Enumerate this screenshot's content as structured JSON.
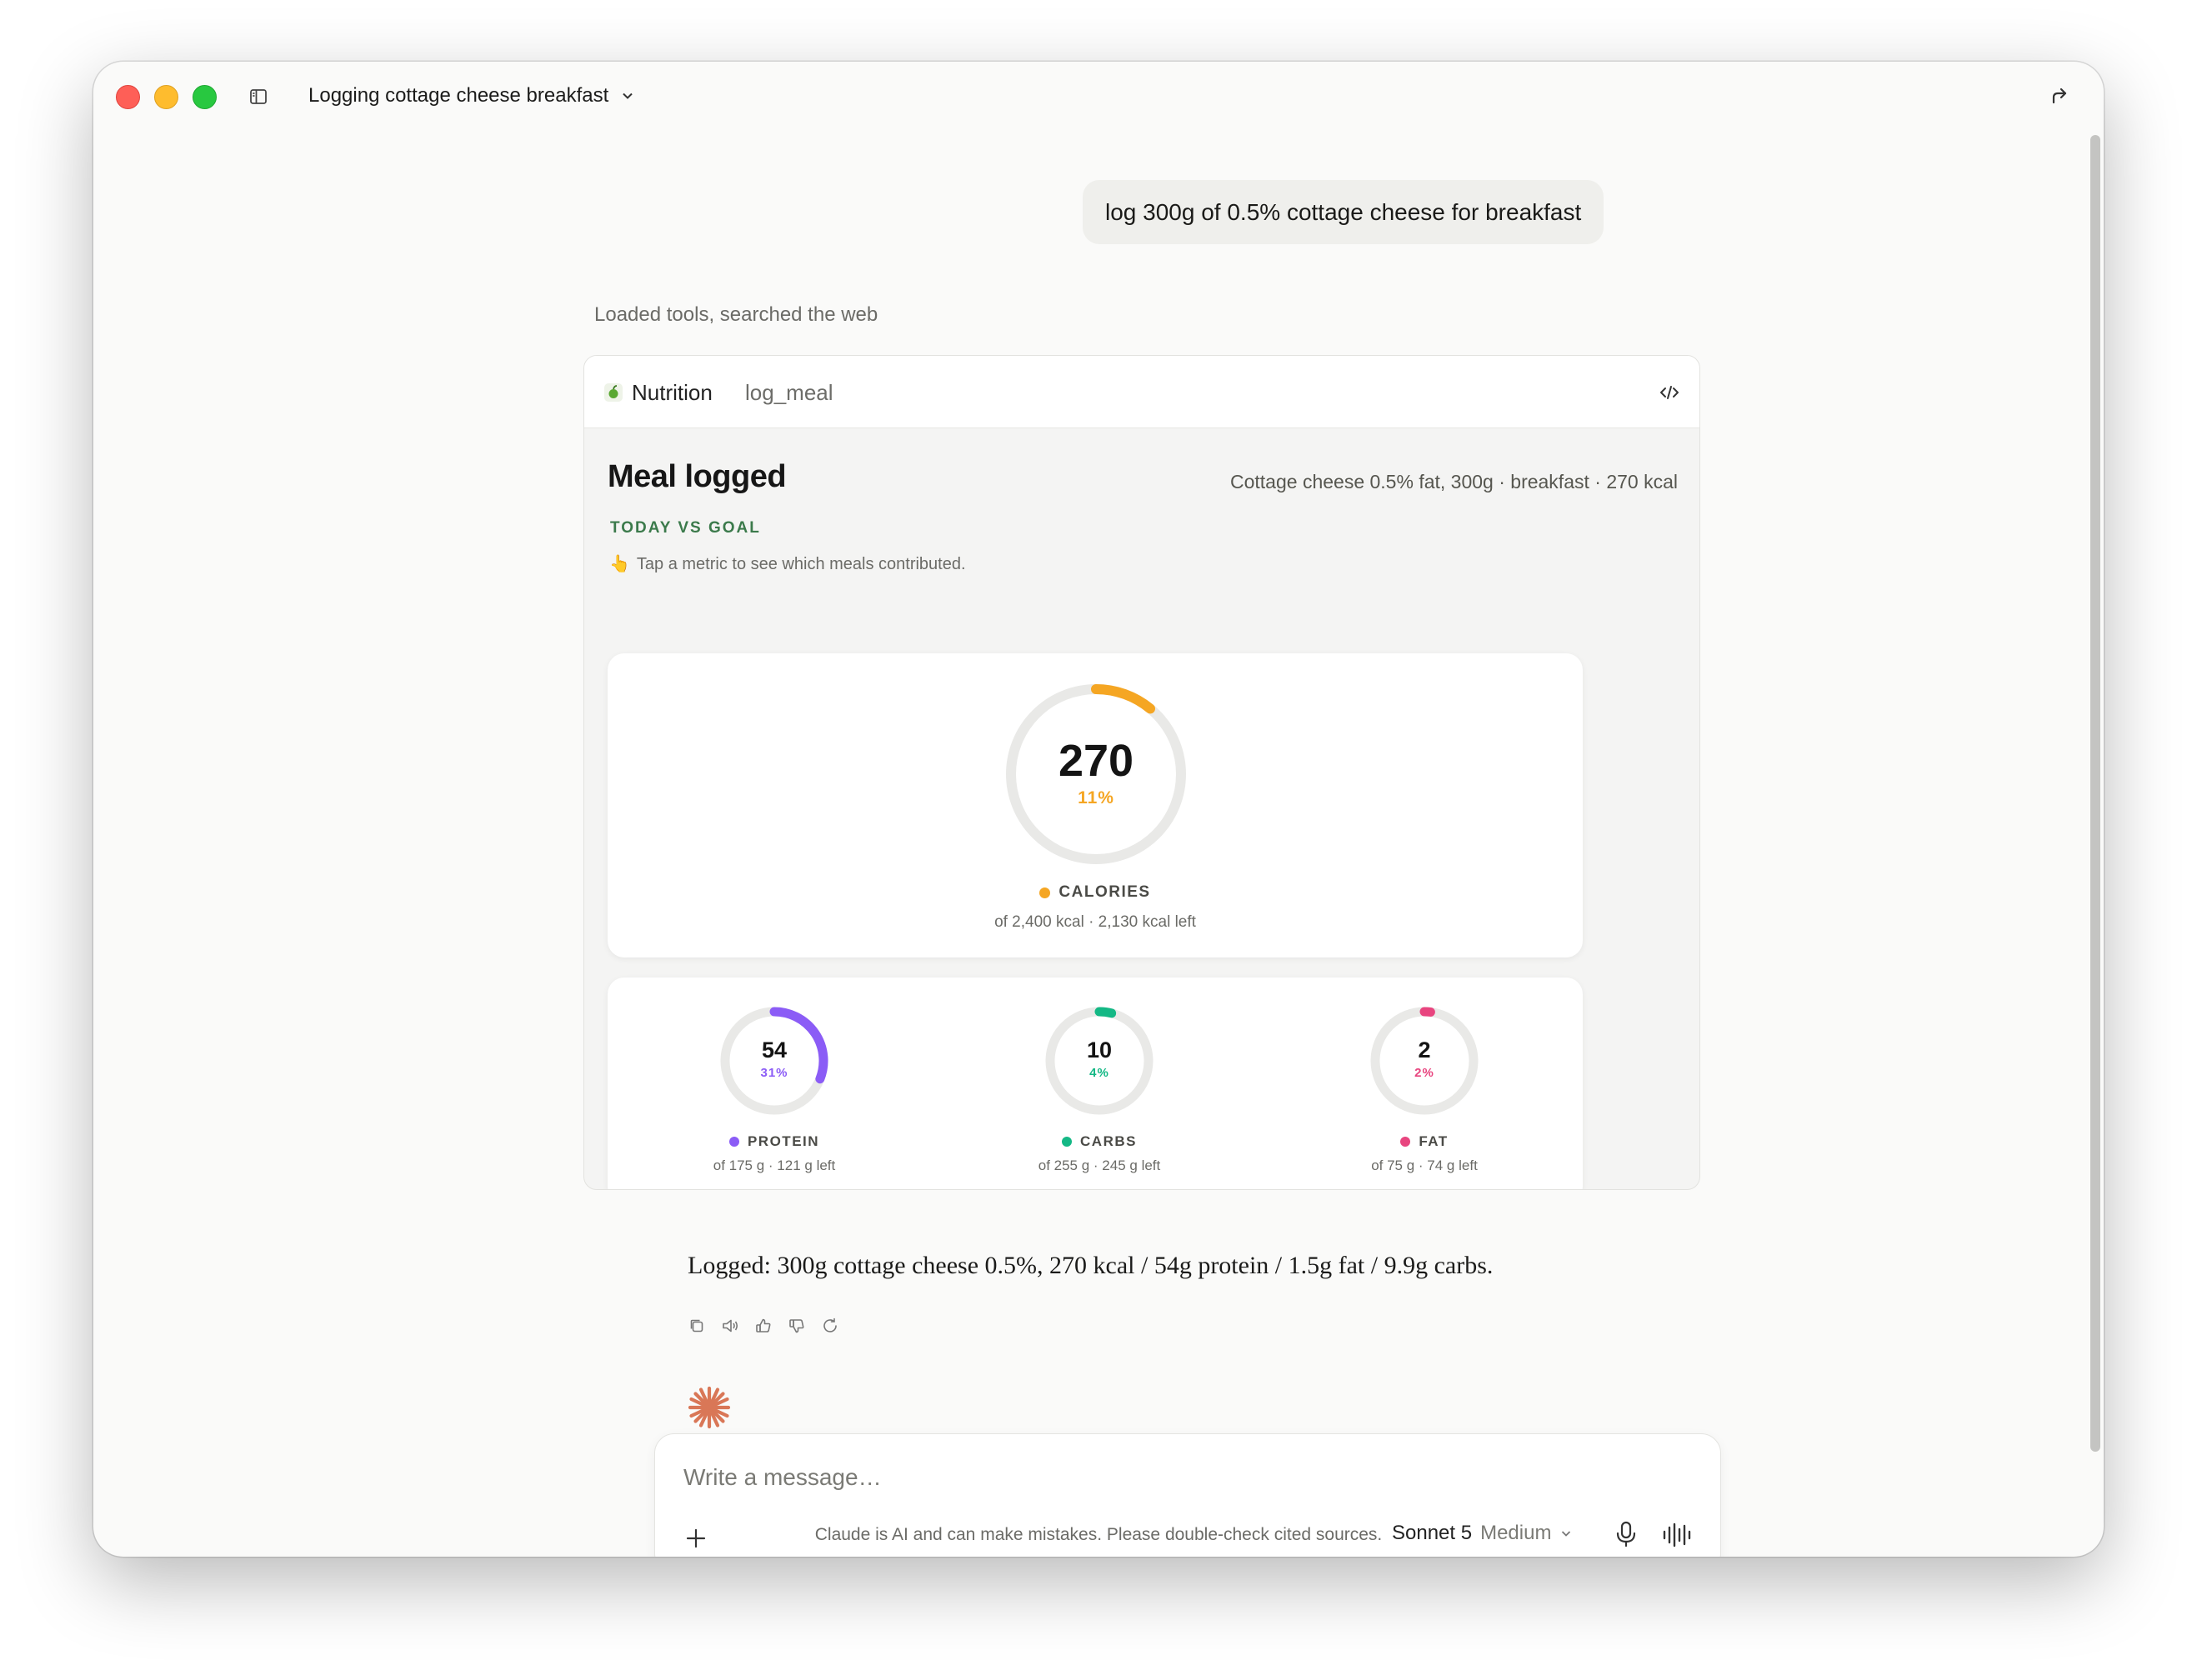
{
  "window": {
    "title": "Logging cottage cheese breakfast"
  },
  "conversation": {
    "user_message": "log 300g of 0.5% cottage cheese for breakfast",
    "tools_status": "Loaded tools, searched the web",
    "response_text": "Logged: 300g cottage cheese 0.5%, 270 kcal / 54g protein / 1.5g fat / 9.9g carbs."
  },
  "tool_card": {
    "app_name": "Nutrition",
    "tool_name": "log_meal",
    "heading": "Meal logged",
    "summary": "Cottage cheese 0.5% fat, 300g · breakfast · 270 kcal",
    "section_label": "TODAY VS GOAL",
    "hint_icon": "👆",
    "hint": "Tap a metric to see which meals contributed.",
    "calories": {
      "value": "270",
      "percent_label": "11%",
      "fraction": 0.11,
      "label": "CALORIES",
      "sub": "of 2,400 kcal · 2,130 kcal left",
      "color": "#f5a623"
    },
    "macros": [
      {
        "key": "protein",
        "value": "54",
        "percent_label": "31%",
        "fraction": 0.31,
        "label": "PROTEIN",
        "sub": "of 175 g · 121 g left",
        "color": "#8b5cf6"
      },
      {
        "key": "carbs",
        "value": "10",
        "percent_label": "4%",
        "fraction": 0.04,
        "label": "CARBS",
        "sub": "of 255 g · 245 g left",
        "color": "#14b885"
      },
      {
        "key": "fat",
        "value": "2",
        "percent_label": "2%",
        "fraction": 0.02,
        "label": "FAT",
        "sub": "of 75 g · 74 g left",
        "color": "#e8457f"
      }
    ]
  },
  "composer": {
    "placeholder": "Write a message…",
    "model": "Sonnet 5",
    "effort": "Medium"
  },
  "disclaimer": "Claude is AI and can make mistakes. Please double-check cited sources.",
  "icons": [
    "sidebar-toggle-icon",
    "chevron-down-icon",
    "share-icon",
    "code-icon",
    "copy-icon",
    "speaker-icon",
    "thumbs-up-icon",
    "thumbs-down-icon",
    "retry-icon",
    "claude-spark-icon",
    "plus-icon",
    "mic-icon",
    "voice-wave-icon"
  ]
}
